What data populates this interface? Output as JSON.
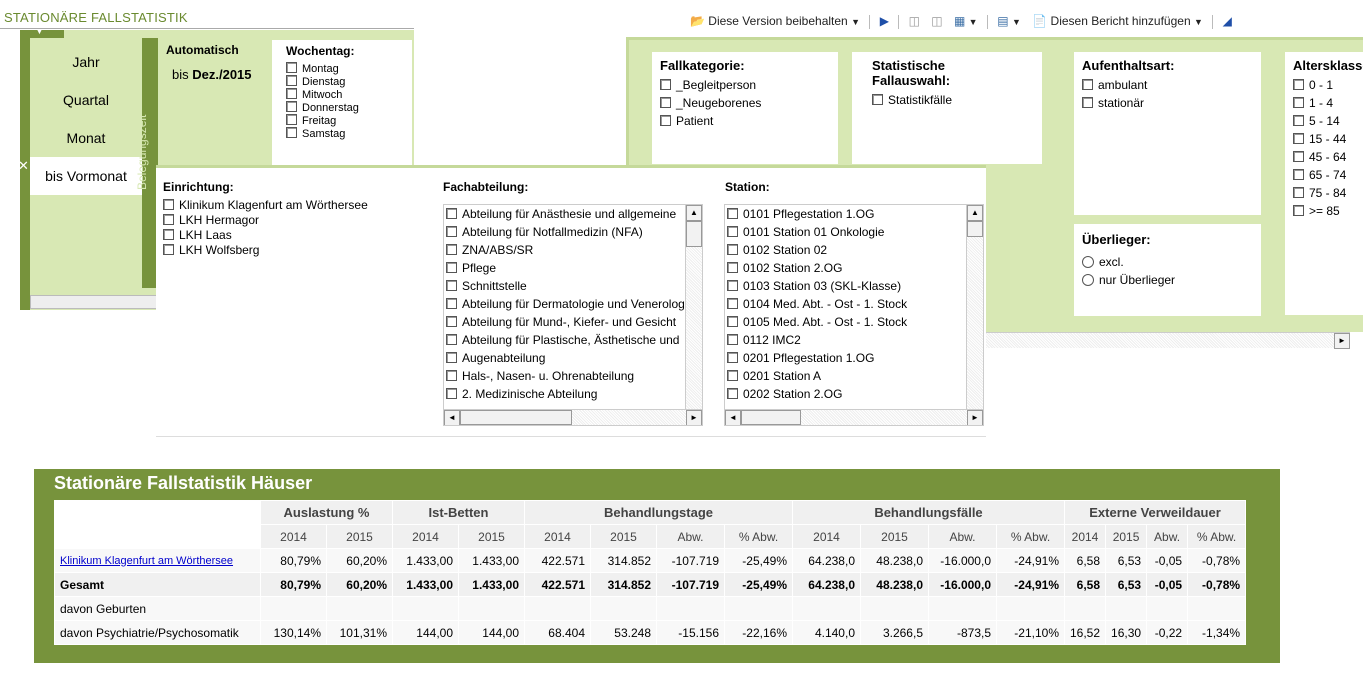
{
  "app": {
    "title": "STATIONÄRE FALLSTATISTIK"
  },
  "toolbar": {
    "keep_version": "Diese Version beibehalten",
    "add_report": "Diesen Bericht hinzufügen"
  },
  "time_panel": {
    "items": [
      "Jahr",
      "Quartal",
      "Monat",
      "bis Vormonat"
    ],
    "vertical_label": "Belegungszeit",
    "auto_label": "Automatisch",
    "auto_prefix": "bis",
    "auto_value": "Dez./2015",
    "weekday_title": "Wochentag:",
    "weekdays": [
      "Montag",
      "Dienstag",
      "Mitwoch",
      "Donnerstag",
      "Freitag",
      "Samstag"
    ]
  },
  "fallkategorie": {
    "title": "Fallkategorie:",
    "options": [
      "_Begleitperson",
      "_Neugeborenes",
      "Patient"
    ]
  },
  "fallauswahl": {
    "title": "Statistische Fallauswahl:",
    "options": [
      "Statistikfälle"
    ]
  },
  "aufenthaltsart": {
    "title": "Aufenthaltsart:",
    "options": [
      "ambulant",
      "stationär"
    ]
  },
  "altersklasse": {
    "title": "Altersklasse",
    "options": [
      "0 - 1",
      "1 - 4",
      "5 - 14",
      "15 - 44",
      "45 - 64",
      "65 - 74",
      "75 - 84",
      ">= 85"
    ]
  },
  "ueberlieger": {
    "title": "Überlieger:",
    "options": [
      "excl.",
      "nur Überlieger"
    ]
  },
  "einrichtung": {
    "title": "Einrichtung:",
    "options": [
      "Klinikum Klagenfurt am Wörthersee",
      "LKH Hermagor",
      "LKH Laas",
      "LKH Wolfsberg"
    ]
  },
  "fachabteilung": {
    "title": "Fachabteilung:",
    "options": [
      "Abteilung für Anästhesie und allgemeine",
      "Abteilung für Notfallmedizin (NFA)",
      "ZNA/ABS/SR",
      "Pflege",
      "Schnittstelle",
      "Abteilung für Dermatologie und Venerolog",
      "Abteilung für Mund-, Kiefer- und Gesicht",
      "Abteilung für Plastische, Ästhetische und",
      "Augenabteilung",
      "Hals-, Nasen- u. Ohrenabteilung",
      "2. Medizinische Abteilung"
    ]
  },
  "station": {
    "title": "Station:",
    "options": [
      "0101 Pflegestation 1.OG",
      "0101 Station 01 Onkologie",
      "0102 Station 02",
      "0102 Station 2.OG",
      "0103 Station 03 (SKL-Klasse)",
      "0104 Med. Abt. - Ost - 1. Stock",
      "0105 Med. Abt. - Ost - 1. Stock",
      "0112 IMC2",
      "0201 Pflegestation 1.OG",
      "0201 Station A",
      "0202 Station 2.OG"
    ]
  },
  "report": {
    "title": "Stationäre Fallstatistik Häuser",
    "groups": [
      "Auslastung %",
      "Ist-Betten",
      "Behandlungstage",
      "Behandlungsfälle",
      "Externe Verweildauer"
    ],
    "subheaders": [
      "2014",
      "2015",
      "2014",
      "2015",
      "2014",
      "2015",
      "Abw.",
      "% Abw.",
      "2014",
      "2015",
      "Abw.",
      "% Abw.",
      "2014",
      "2015",
      "Abw.",
      "% Abw."
    ],
    "rows": [
      {
        "label": "Klinikum Klagenfurt am Wörthersee",
        "cells": [
          "80,79%",
          "60,20%",
          "1.433,00",
          "1.433,00",
          "422.571",
          "314.852",
          "-107.719",
          "-25,49%",
          "64.238,0",
          "48.238,0",
          "-16.000,0",
          "-24,91%",
          "6,58",
          "6,53",
          "-0,05",
          "-0,78%"
        ]
      },
      {
        "label": "Gesamt",
        "cells": [
          "80,79%",
          "60,20%",
          "1.433,00",
          "1.433,00",
          "422.571",
          "314.852",
          "-107.719",
          "-25,49%",
          "64.238,0",
          "48.238,0",
          "-16.000,0",
          "-24,91%",
          "6,58",
          "6,53",
          "-0,05",
          "-0,78%"
        ]
      },
      {
        "label": "davon Geburten",
        "cells": [
          "",
          "",
          "",
          "",
          "",
          "",
          "",
          "",
          "",
          "",
          "",
          "",
          "",
          "",
          "",
          ""
        ]
      },
      {
        "label": "davon Psychiatrie/Psychosomatik",
        "cells": [
          "130,14%",
          "101,31%",
          "144,00",
          "144,00",
          "68.404",
          "53.248",
          "-15.156",
          "-22,16%",
          "4.140,0",
          "3.266,5",
          "-873,5",
          "-21,10%",
          "16,52",
          "16,30",
          "-0,22",
          "-1,34%"
        ]
      }
    ]
  },
  "colors": {
    "green_dark": "#77933c",
    "green_light": "#d8e8b4",
    "link": "#0000cc"
  }
}
